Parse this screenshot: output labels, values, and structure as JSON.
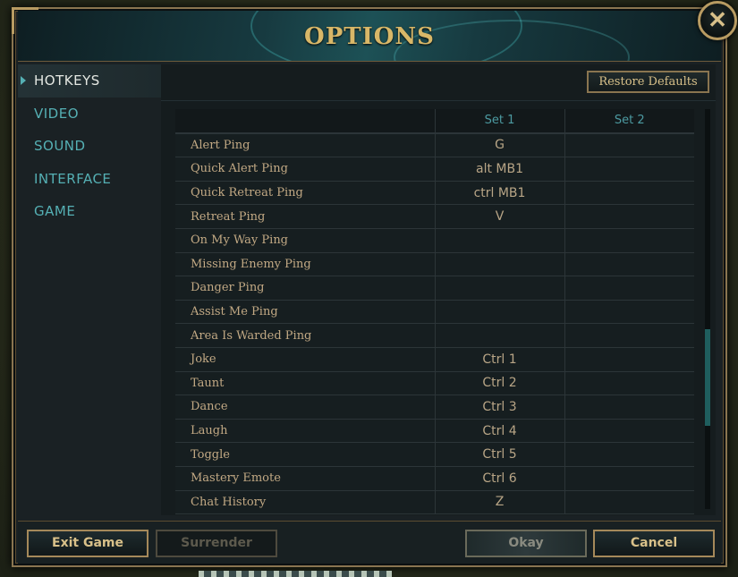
{
  "window": {
    "title": "OPTIONS",
    "close_glyph": "✕"
  },
  "sidebar": {
    "items": [
      {
        "label": "HOTKEYS",
        "active": true
      },
      {
        "label": "VIDEO"
      },
      {
        "label": "SOUND"
      },
      {
        "label": "INTERFACE"
      },
      {
        "label": "GAME"
      }
    ]
  },
  "panel": {
    "restore_label": "Restore Defaults",
    "columns": [
      "",
      "Set 1",
      "Set 2"
    ],
    "rows": [
      {
        "name": "Alert Ping",
        "set1": "G",
        "set2": ""
      },
      {
        "name": "Quick Alert Ping",
        "set1": "alt  MB1",
        "set2": ""
      },
      {
        "name": "Quick Retreat Ping",
        "set1": "ctrl  MB1",
        "set2": ""
      },
      {
        "name": "Retreat Ping",
        "set1": "V",
        "set2": ""
      },
      {
        "name": "On My Way Ping",
        "set1": "",
        "set2": ""
      },
      {
        "name": "Missing Enemy Ping",
        "set1": "",
        "set2": ""
      },
      {
        "name": "Danger Ping",
        "set1": "",
        "set2": ""
      },
      {
        "name": "Assist Me Ping",
        "set1": "",
        "set2": ""
      },
      {
        "name": "Area Is Warded Ping",
        "set1": "",
        "set2": ""
      },
      {
        "name": "Joke",
        "set1": "Ctrl  1",
        "set2": ""
      },
      {
        "name": "Taunt",
        "set1": "Ctrl  2",
        "set2": ""
      },
      {
        "name": "Dance",
        "set1": "Ctrl  3",
        "set2": ""
      },
      {
        "name": "Laugh",
        "set1": "Ctrl  4",
        "set2": ""
      },
      {
        "name": "Toggle",
        "set1": "Ctrl  5",
        "set2": ""
      },
      {
        "name": "Mastery Emote",
        "set1": "Ctrl  6",
        "set2": ""
      },
      {
        "name": "Chat History",
        "set1": "Z",
        "set2": ""
      }
    ]
  },
  "footer": {
    "exit_label": "Exit Game",
    "surrender_label": "Surrender",
    "okay_label": "Okay",
    "cancel_label": "Cancel"
  },
  "colors": {
    "accent_gold": "#d8b768",
    "accent_teal": "#55b0b4",
    "panel_bg": "#151c1e"
  }
}
